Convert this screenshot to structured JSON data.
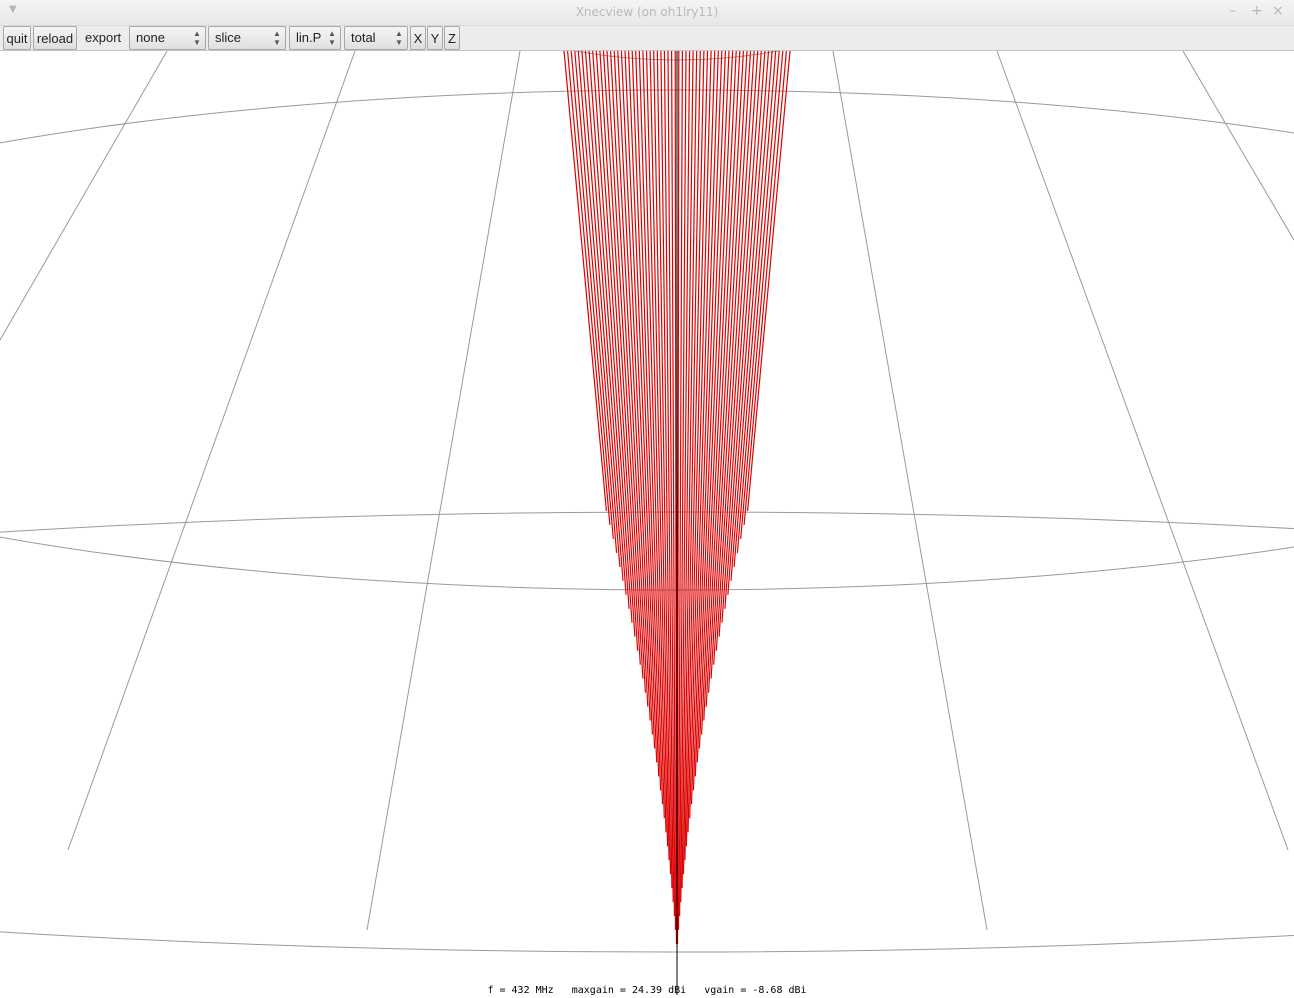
{
  "window": {
    "title": "Xnecview (on oh1lry11)",
    "menu_icon": "window-menu-icon",
    "minimize_icon": "–",
    "maximize_icon": "+",
    "close_icon": "×"
  },
  "toolbar": {
    "quit_label": "quit",
    "reload_label": "reload",
    "export_label": "export",
    "export_select": "none",
    "view_select": "slice",
    "scale_select": "lin.P",
    "polarization_select": "total",
    "x_label": "X",
    "y_label": "Y",
    "z_label": "Z",
    "spinner_glyph": "▲\n▼"
  },
  "status": {
    "text": "f = 432 MHz   maxgain = 24.39 dBi   vgain = -8.68 dBi"
  },
  "colors": {
    "pattern": "#dd0000",
    "grid": "#9a9a9a",
    "axis": "#000000",
    "background": "#ffffff"
  }
}
